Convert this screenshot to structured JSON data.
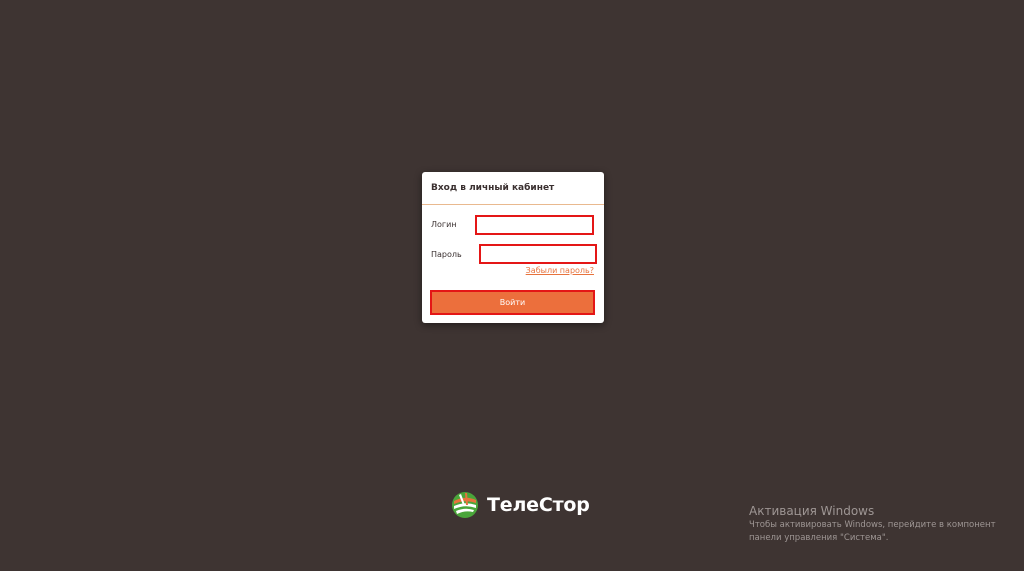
{
  "login_form": {
    "title": "Вход в личный кабинет",
    "login_label": "Логин",
    "login_value": "",
    "password_label": "Пароль",
    "password_value": "",
    "forgot_password_link": "Забыли пароль?",
    "submit_label": "Войти"
  },
  "brand": {
    "name": "ТелеСтор",
    "logo_icon": "telestor-leaf-logo-icon"
  },
  "windows_activation": {
    "title": "Активация Windows",
    "line1": "Чтобы активировать Windows, перейдите в компонент",
    "line2": "панели управления \"Система\"."
  },
  "colors": {
    "background": "#3e3432",
    "accent": "#ec6f3c",
    "error_outline": "#e41616",
    "header_divider": "#e9b98f",
    "logo_green": "#4aa53a",
    "logo_orange": "#e7733d"
  }
}
